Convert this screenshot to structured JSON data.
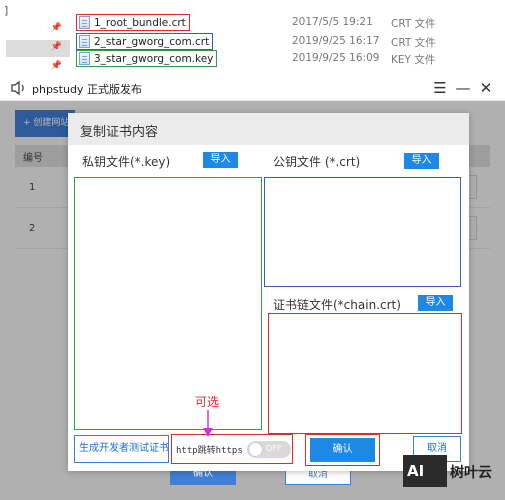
{
  "explorer": {
    "bracket": "]",
    "files": [
      {
        "name": "1_root_bundle.crt",
        "date": "2017/5/5 19:21",
        "type": "CRT 文件"
      },
      {
        "name": "2_star_gworg_com.crt",
        "date": "2019/9/25 16:17",
        "type": "CRT 文件"
      },
      {
        "name": "3_star_gworg_com.key",
        "date": "2019/9/25 16:09",
        "type": "KEY 文件"
      }
    ]
  },
  "window": {
    "title": "phpstudy 正式版发布",
    "create_site_label": "+ 创建网站",
    "table_header_id": "编号",
    "rows": [
      "1",
      "2"
    ],
    "bg_confirm": "确认",
    "bg_cancel": "取消"
  },
  "dialog": {
    "title": "复制证书内容",
    "private_key_label": "私钥文件(*.key)",
    "public_key_label": "公钥文件 (*.crt)",
    "chain_label": "证书链文件(*chain.crt)",
    "import_label": "导入",
    "gen_test_cert": "生成开发者测试证书",
    "https_redirect_label": "http跳转https",
    "toggle_state": "OFF",
    "confirm": "确认",
    "cancel": "取消"
  },
  "annotation": {
    "text": "可选",
    "color": "#e02b2b"
  },
  "watermark": {
    "logo": "AI",
    "text": "树叶云"
  },
  "colors": {
    "accent": "#1e88e5",
    "red": "#e02b2b",
    "green": "#2ea043",
    "blue": "#3a5fb8"
  }
}
